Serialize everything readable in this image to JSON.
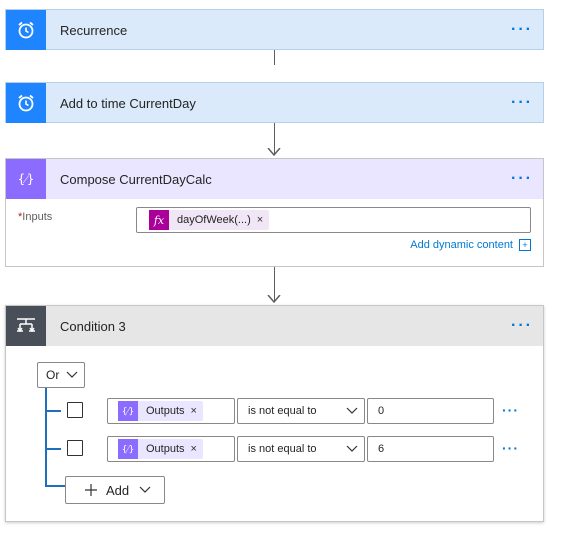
{
  "recurrence": {
    "title": "Recurrence",
    "icon": "alarm-clock-icon",
    "color": "#1f85ff"
  },
  "add_to_time": {
    "title": "Add to time CurrentDay",
    "icon": "alarm-clock-icon",
    "color": "#1f85ff"
  },
  "compose": {
    "title": "Compose CurrentDayCalc",
    "icon": "compose-variable-icon",
    "color": "#8c6cff",
    "inputs_label": "Inputs",
    "required_mark": "*",
    "token": {
      "label": "dayOfWeek(...)",
      "icon": "fx-icon",
      "color": "#aa0099"
    },
    "add_dynamic_content": "Add dynamic content"
  },
  "condition": {
    "title": "Condition 3",
    "icon": "condition-icon",
    "color": "#484f58",
    "operator": "Or",
    "rows": [
      {
        "left_token": "Outputs",
        "comparator": "is not equal to",
        "value": "0"
      },
      {
        "left_token": "Outputs",
        "comparator": "is not equal to",
        "value": "6"
      }
    ],
    "add_label": "Add"
  },
  "more_glyph": "···",
  "remove_glyph": "×"
}
